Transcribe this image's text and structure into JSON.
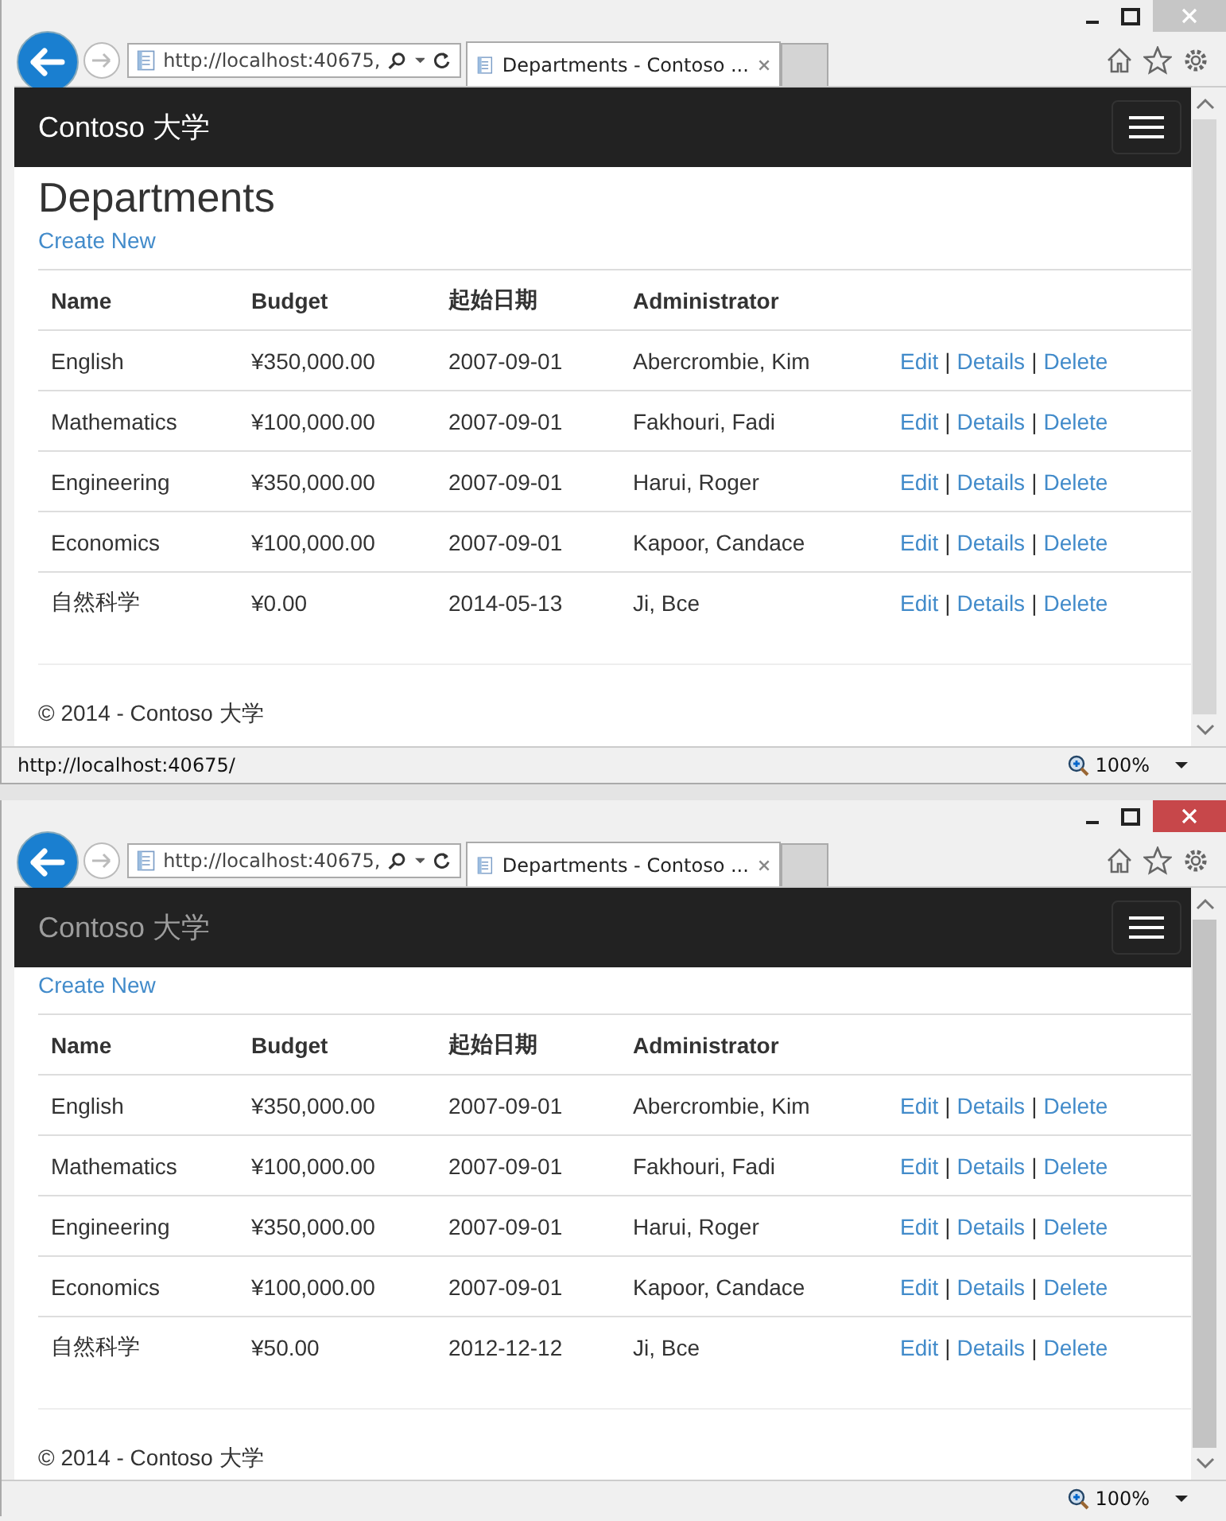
{
  "windows": [
    {
      "active": false,
      "address": "http://localhost:40675,",
      "tab_title": "Departments - Contoso ...",
      "brand": "Contoso 大学",
      "brand_dimmed": false,
      "heading": "Departments",
      "create_link": "Create New",
      "table": {
        "columns": [
          "Name",
          "Budget",
          "起始日期",
          "Administrator"
        ],
        "rows": [
          {
            "cells": [
              "English",
              "¥350,000.00",
              "2007-09-01",
              "Abercrombie, Kim"
            ],
            "actions": [
              "Edit",
              "|",
              "Details",
              "|",
              "Delete"
            ]
          },
          {
            "cells": [
              "Mathematics",
              "¥100,000.00",
              "2007-09-01",
              "Fakhouri, Fadi"
            ],
            "actions": [
              "Edit",
              "|",
              "Details",
              "|",
              "Delete"
            ]
          },
          {
            "cells": [
              "Engineering",
              "¥350,000.00",
              "2007-09-01",
              "Harui, Roger"
            ],
            "actions": [
              "Edit",
              "|",
              "Details",
              "|",
              "Delete"
            ]
          },
          {
            "cells": [
              "Economics",
              "¥100,000.00",
              "2007-09-01",
              "Kapoor, Candace"
            ],
            "actions": [
              "Edit",
              "|",
              "Details",
              "|",
              "Delete"
            ]
          },
          {
            "cells": [
              "自然科学",
              "¥0.00",
              "2014-05-13",
              "Ji, Bce"
            ],
            "actions": [
              "Edit",
              "|",
              "Details",
              "|",
              "Delete"
            ]
          }
        ]
      },
      "footer": "© 2014 - Contoso 大学",
      "status_url": "http://localhost:40675/",
      "zoom": "100%"
    },
    {
      "active": true,
      "address": "http://localhost:40675,",
      "tab_title": "Departments - Contoso ...",
      "brand": "Contoso 大学",
      "brand_dimmed": true,
      "create_link": "Create New",
      "table": {
        "columns": [
          "Name",
          "Budget",
          "起始日期",
          "Administrator"
        ],
        "rows": [
          {
            "cells": [
              "English",
              "¥350,000.00",
              "2007-09-01",
              "Abercrombie, Kim"
            ],
            "actions": [
              "Edit",
              "|",
              "Details",
              "|",
              "Delete"
            ]
          },
          {
            "cells": [
              "Mathematics",
              "¥100,000.00",
              "2007-09-01",
              "Fakhouri, Fadi"
            ],
            "actions": [
              "Edit",
              "|",
              "Details",
              "|",
              "Delete"
            ]
          },
          {
            "cells": [
              "Engineering",
              "¥350,000.00",
              "2007-09-01",
              "Harui, Roger"
            ],
            "actions": [
              "Edit",
              "|",
              "Details",
              "|",
              "Delete"
            ]
          },
          {
            "cells": [
              "Economics",
              "¥100,000.00",
              "2007-09-01",
              "Kapoor, Candace"
            ],
            "actions": [
              "Edit",
              "|",
              "Details",
              "|",
              "Delete"
            ]
          },
          {
            "cells": [
              "自然科学",
              "¥50.00",
              "2012-12-12",
              "Ji, Bce"
            ],
            "actions": [
              "Edit",
              "|",
              "Details",
              "|",
              "Delete"
            ]
          }
        ]
      },
      "footer": "© 2014 - Contoso 大学",
      "zoom": "100%"
    }
  ]
}
